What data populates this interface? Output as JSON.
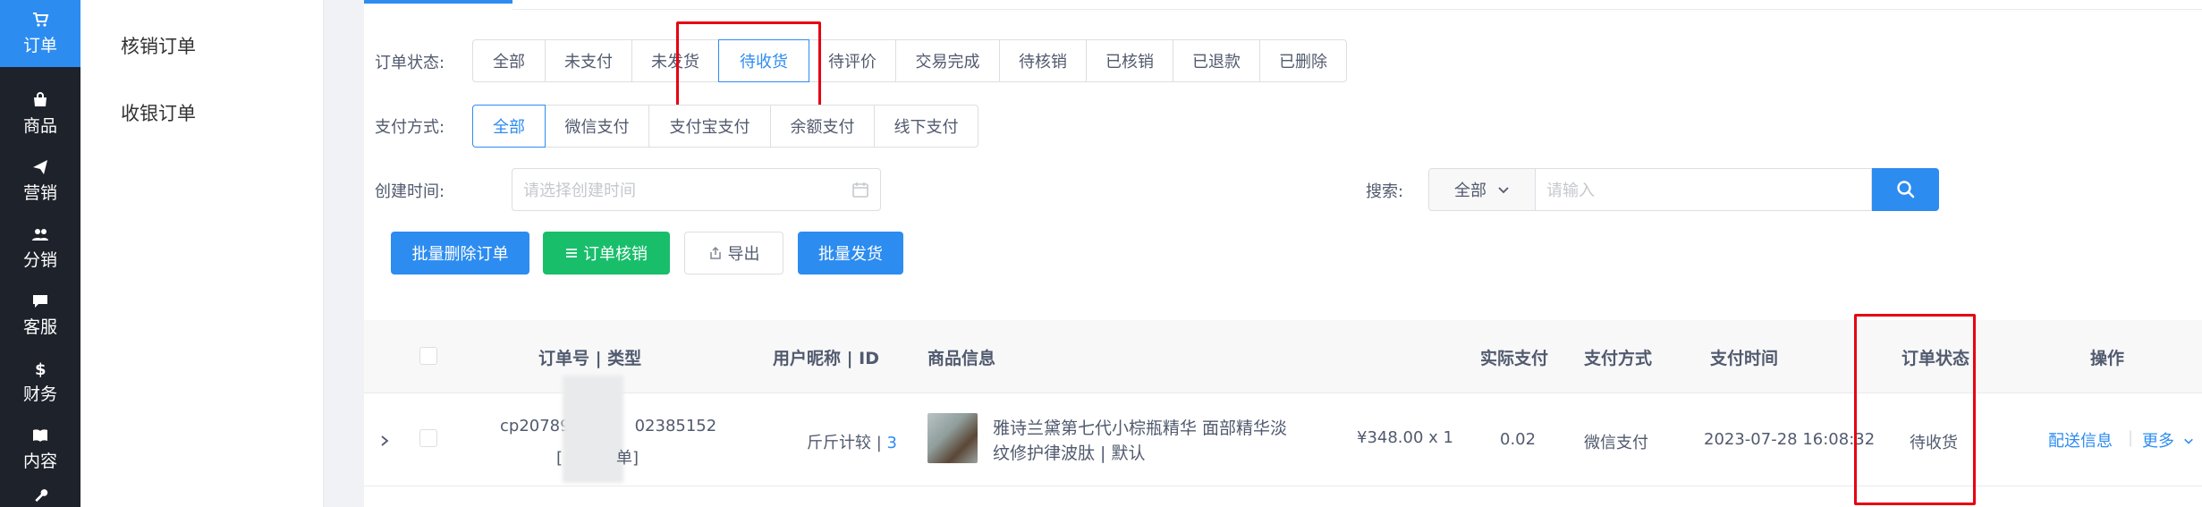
{
  "rail": [
    {
      "label": "订单",
      "icon": "cart-icon",
      "active": true
    },
    {
      "label": "商品",
      "icon": "shop-icon",
      "active": false
    },
    {
      "label": "营销",
      "icon": "send-icon",
      "active": false
    },
    {
      "label": "分销",
      "icon": "people-icon",
      "active": false
    },
    {
      "label": "客服",
      "icon": "chat-icon",
      "active": false
    },
    {
      "label": "财务",
      "icon": "dollar-icon",
      "active": false
    },
    {
      "label": "内容",
      "icon": "book-icon",
      "active": false
    }
  ],
  "submenu": [
    "核销订单",
    "收银订单"
  ],
  "filters": {
    "status_label": "订单状态:",
    "status_options": [
      "全部",
      "未支付",
      "未发货",
      "待收货",
      "待评价",
      "交易完成",
      "待核销",
      "已核销",
      "已退款",
      "已删除"
    ],
    "status_selected": "待收货",
    "pay_label": "支付方式:",
    "pay_options": [
      "全部",
      "微信支付",
      "支付宝支付",
      "余额支付",
      "线下支付"
    ],
    "pay_selected": "全部",
    "date_label": "创建时间:",
    "date_placeholder": "请选择创建时间",
    "search_label": "搜索:",
    "search_scope": "全部",
    "search_placeholder": "请输入"
  },
  "actions": {
    "batch_delete": "批量删除订单",
    "verify": "订单核销",
    "export": "导出",
    "batch_ship": "批量发货"
  },
  "table": {
    "headers": {
      "order": "订单号 | 类型",
      "user": "用户昵称 | ID",
      "goods": "商品信息",
      "paid": "实际支付",
      "method": "支付方式",
      "time": "支付时间",
      "status": "订单状态",
      "ops": "操作"
    },
    "rows": [
      {
        "order_no_visible_start": "cp20789",
        "order_no_visible_end": "02385152",
        "order_type_end": "单]",
        "user_name": "斤斤计较",
        "user_sep": " | ",
        "user_id": "3",
        "goods_title_line1": "雅诗兰黛第七代小棕瓶精华 面部精华淡",
        "goods_title_line2": "纹修护律波肽 | 默认",
        "price_qty": "¥348.00 x 1",
        "paid": "0.02",
        "method": "微信支付",
        "time": "2023-07-28 16:08:32",
        "status": "待收货",
        "op_ship_info": "配送信息",
        "op_more": "更多"
      }
    ]
  },
  "colors": {
    "accent": "#2d8cf0",
    "green": "#19be6b",
    "rail_bg": "#1e222b",
    "highlight": "#e60012"
  }
}
